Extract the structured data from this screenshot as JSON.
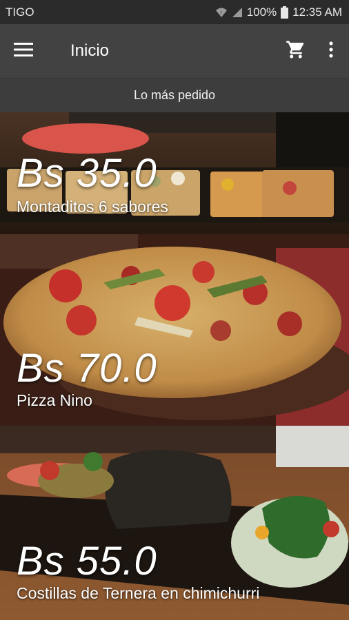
{
  "status_bar": {
    "carrier": "TIGO",
    "battery": "100%",
    "time": "12:35 AM"
  },
  "app_bar": {
    "title": "Inicio",
    "menu_icon": "hamburger-menu-icon",
    "cart_icon": "shopping-cart-icon",
    "more_icon": "more-vert-icon"
  },
  "section": {
    "title": "Lo más pedido"
  },
  "products": [
    {
      "price": "Bs 35.0",
      "name": "Montaditos 6 sabores"
    },
    {
      "price": "Bs 70.0",
      "name": "Pizza Nino"
    },
    {
      "price": "Bs 55.0",
      "name": "Costillas de Ternera en chimichurri"
    }
  ]
}
